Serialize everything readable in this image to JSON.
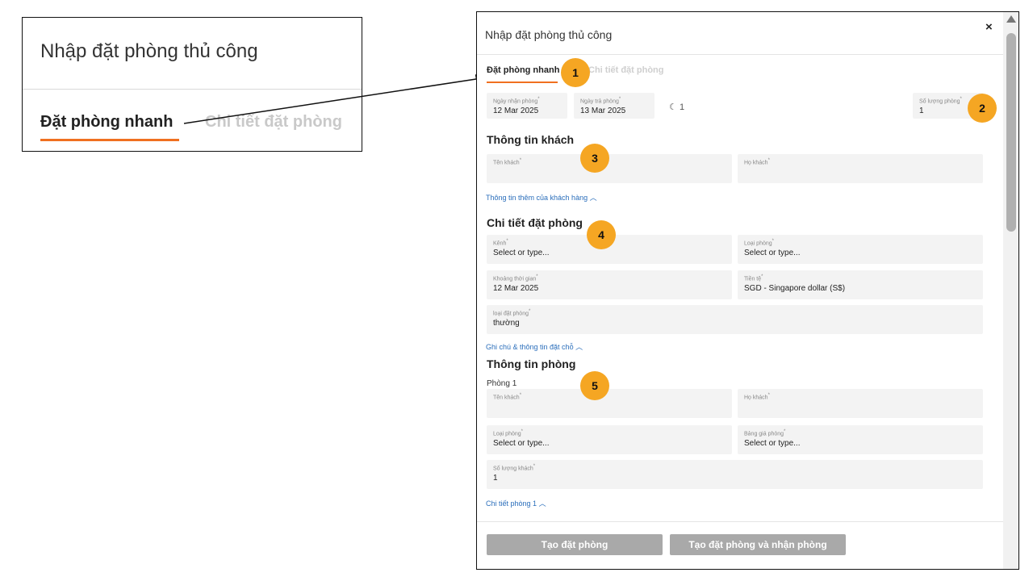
{
  "callout": {
    "title": "Nhập đặt phòng thủ công",
    "tab_active": "Đặt phòng nhanh",
    "tab_inactive": "Chi tiết đặt phòng"
  },
  "modal": {
    "title": "Nhập đặt phòng thủ công",
    "close": "×",
    "tabs": {
      "quick": "Đặt phòng nhanh",
      "detail": "Chi tiết đặt phòng"
    },
    "dates": {
      "checkin_label": "Ngày nhận phòng",
      "checkin_value": "12 Mar 2025",
      "checkout_label": "Ngày trả phòng",
      "checkout_value": "13 Mar 2025",
      "nights": "1",
      "rooms_label": "Số lượng phòng",
      "rooms_value": "1"
    },
    "guest": {
      "title": "Thông tin khách",
      "first_name_label": "Tên khách",
      "last_name_label": "Họ khách",
      "more_link": "Thông tin thêm của khách hàng"
    },
    "booking": {
      "title": "Chi tiết đặt phòng",
      "channel_label": "Kênh",
      "channel_value": "Select or type...",
      "room_type_label": "Loại phòng",
      "room_type_value": "Select or type...",
      "period_label": "Khoảng thời gian",
      "period_value": "12 Mar 2025",
      "currency_label": "Tiền tệ",
      "currency_value": "SGD - Singapore dollar (S$)",
      "booking_type_label": "loại đặt phòng",
      "booking_type_value": "thường",
      "notes_link": "Ghi chú & thông tin đặt chỗ"
    },
    "room": {
      "title": "Thông tin phòng",
      "room_label": "Phòng 1",
      "first_name_label": "Tên khách",
      "last_name_label": "Họ khách",
      "room_type_label": "Loại phòng",
      "room_type_value": "Select or type...",
      "rate_label": "Bảng giá phòng",
      "rate_value": "Select or type...",
      "guests_label": "Số lượng khách",
      "guests_value": "1",
      "detail_link": "Chi tiết phòng 1"
    },
    "buttons": {
      "create": "Tạo đặt phòng",
      "create_checkin": "Tạo đặt phòng và nhận phòng"
    }
  },
  "badges": [
    "1",
    "2",
    "3",
    "4",
    "5"
  ],
  "colors": {
    "accent": "#f07020",
    "badge": "#f5a623",
    "link": "#2a6ebb",
    "button": "#a9a9a9"
  }
}
